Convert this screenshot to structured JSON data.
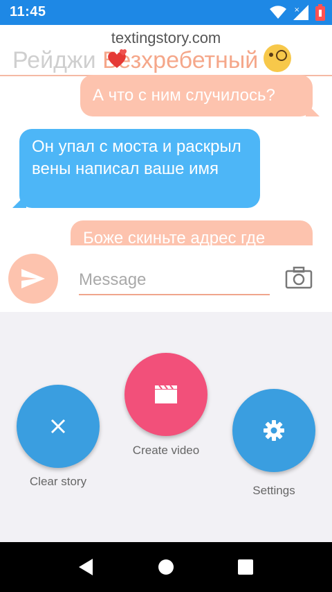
{
  "status_bar": {
    "time": "11:45"
  },
  "chat": {
    "watermark": "textingstory.com",
    "contact_name_part1": "Рейджи ",
    "contact_name_part2": "Безхребетный",
    "messages": [
      {
        "side": "out",
        "text": "А что с ним случилось?"
      },
      {
        "side": "in",
        "text": "Он упал с моста и раскрыл вены написал ваше имя"
      },
      {
        "side": "out",
        "text": "Боже скиньте адрес где"
      }
    ],
    "composer": {
      "placeholder": "Message"
    }
  },
  "actions": {
    "clear_label": "Clear story",
    "create_label": "Create video",
    "settings_label": "Settings"
  },
  "colors": {
    "status_bar": "#1e88e5",
    "outgoing_bubble": "#fdc3ae",
    "incoming_bubble": "#4db6f7",
    "fab_blue": "#3a9ee0",
    "fab_pink": "#f2507a"
  }
}
